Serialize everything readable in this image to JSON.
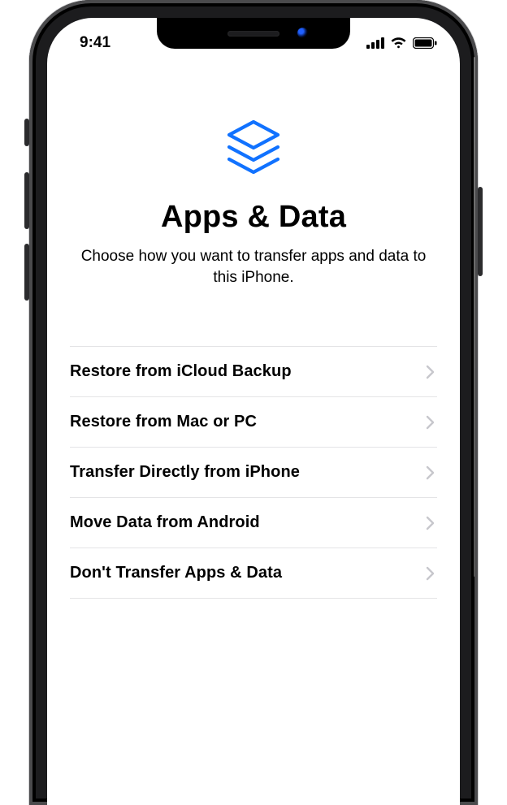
{
  "statusbar": {
    "time": "9:41"
  },
  "page": {
    "icon_name": "layers-icon",
    "title": "Apps & Data",
    "subtitle": "Choose how you want to transfer apps and data to this iPhone."
  },
  "options": [
    {
      "label": "Restore from iCloud Backup"
    },
    {
      "label": "Restore from Mac or PC"
    },
    {
      "label": "Transfer Directly from iPhone"
    },
    {
      "label": "Move Data from Android"
    },
    {
      "label": "Don't Transfer Apps & Data"
    }
  ],
  "colors": {
    "accent": "#1172ff",
    "divider": "#e4e4e6",
    "chevron": "#c7c7cc"
  }
}
